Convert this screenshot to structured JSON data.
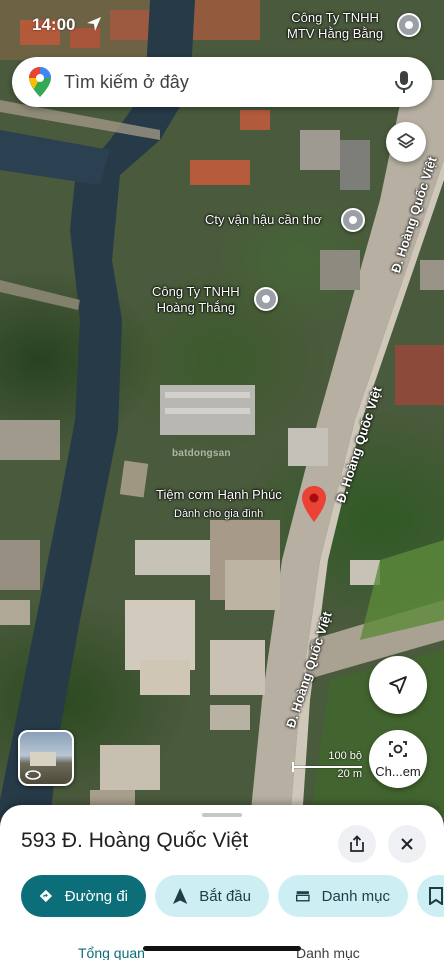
{
  "status_bar": {
    "time": "14:00",
    "location_icon": "location-arrow-icon"
  },
  "search": {
    "placeholder": "Tìm kiếm ở đây",
    "logo_icon": "maps-pin-logo-icon",
    "mic_icon": "microphone-icon"
  },
  "map": {
    "places": [
      {
        "name": "Công Ty TNHH\nMTV Hằng Bằng"
      },
      {
        "name": "Cty vận hậu cần thơ"
      },
      {
        "name": "Công Ty TNHH\nHoàng Thắng"
      },
      {
        "name": "Tiệm cơm Hạnh Phúc",
        "subtitle": "Dành cho gia đình"
      }
    ],
    "road_labels": [
      "Đ. Hoàng Quốc Việt",
      "Đ. Hoàng Quốc Việt",
      "Đ. Hoàng Quốc Việt"
    ],
    "watermark": "batdongsan",
    "scale": {
      "imperial": "100 bộ",
      "metric": "20 m"
    },
    "pin_color": "#ea4335"
  },
  "controls": {
    "layers_icon": "layers-icon",
    "locate_icon": "navigation-arrow-icon",
    "streetview_label": "street-view-thumbnail",
    "ch_button_label": "Ch...em"
  },
  "sheet": {
    "title": "593 Đ. Hoàng Quốc Việt",
    "share_icon": "share-icon",
    "close_icon": "close-icon",
    "actions": [
      {
        "label": "Đường đi",
        "icon": "directions-icon"
      },
      {
        "label": "Bắt đầu",
        "icon": "navigation-icon"
      },
      {
        "label": "Danh mục",
        "icon": "list-icon"
      },
      {
        "label": "",
        "icon": "save-icon"
      }
    ],
    "tabs": [
      "Tổng quan",
      "Danh mục"
    ]
  },
  "colors": {
    "primary": "#0b6e78",
    "secondary_chip": "#cdeff3",
    "pin": "#ea4335"
  }
}
